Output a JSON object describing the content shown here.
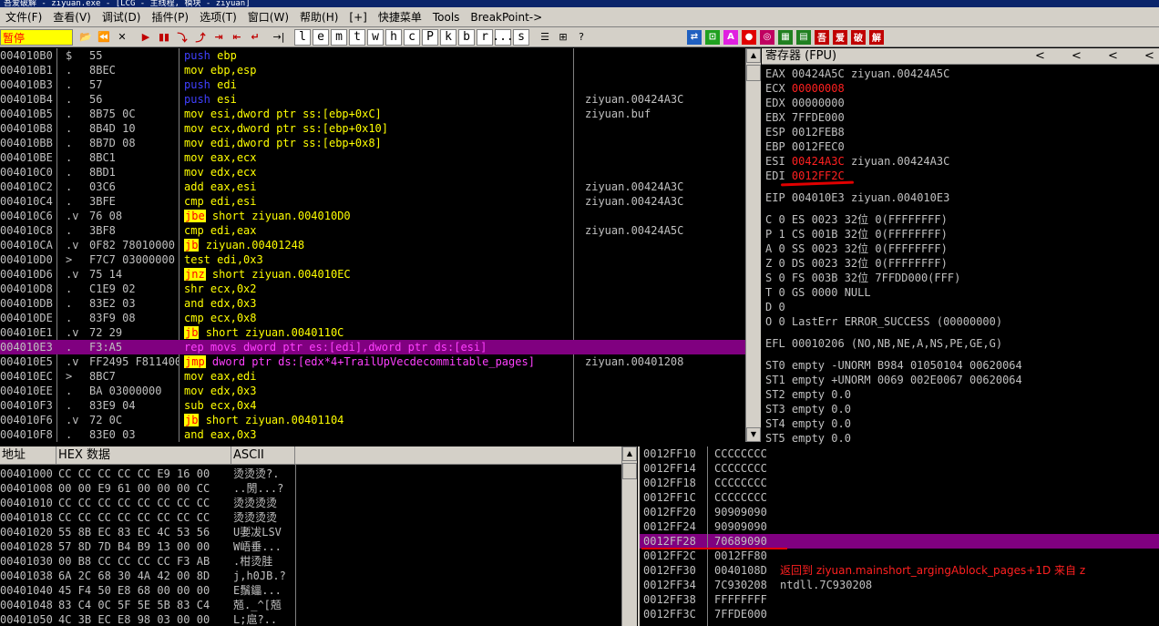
{
  "titlebar": {
    "text": "吾爱破解 - ziyuan.exe - [LCG - 主线程, 模块 - ziyuan]"
  },
  "menu": [
    "文件(F)",
    "查看(V)",
    "调试(D)",
    "插件(P)",
    "选项(T)",
    "窗口(W)",
    "帮助(H)",
    "[+]",
    "快捷菜单",
    "Tools",
    "BreakPoint->"
  ],
  "toolbar": {
    "status": "暂停",
    "buttons_left": [
      "📂",
      "⏪",
      "✕",
      "▶",
      "▮▮",
      "⤵",
      "⤴",
      "⇥",
      "⇤",
      "↵",
      "→|"
    ],
    "letters": [
      "l",
      "e",
      "m",
      "t",
      "w",
      "h",
      "c",
      "P",
      "k",
      "b",
      "r",
      "...",
      "s"
    ],
    "buttons_mid": [
      "☰",
      "⊞",
      "?"
    ],
    "buttons_right": [
      "⇄",
      "⊡",
      "A",
      "●",
      "◎",
      "▦",
      "▤",
      "吾",
      "爱",
      "破",
      "解"
    ]
  },
  "disasm": [
    {
      "addr": "004010B0",
      "mk": "$",
      "hex": "55",
      "op": "push",
      "args": "ebp",
      "opc": "blue",
      "cmt": ""
    },
    {
      "addr": "004010B1",
      "mk": ".",
      "hex": "8BEC",
      "op": "mov",
      "args": "ebp,esp",
      "opc": "yel",
      "cmt": ""
    },
    {
      "addr": "004010B3",
      "mk": ".",
      "hex": "57",
      "op": "push",
      "args": "edi",
      "opc": "blue",
      "cmt": ""
    },
    {
      "addr": "004010B4",
      "mk": ".",
      "hex": "56",
      "op": "push",
      "args": "esi",
      "opc": "blue",
      "cmt": "ziyuan.00424A3C"
    },
    {
      "addr": "004010B5",
      "mk": ".",
      "hex": "8B75 0C",
      "op": "mov",
      "args": "esi,dword ptr ss:[ebp+0xC]",
      "opc": "yel",
      "cmt": "ziyuan.buf"
    },
    {
      "addr": "004010B8",
      "mk": ".",
      "hex": "8B4D 10",
      "op": "mov",
      "args": "ecx,dword ptr ss:[ebp+0x10]",
      "opc": "yel",
      "cmt": ""
    },
    {
      "addr": "004010BB",
      "mk": ".",
      "hex": "8B7D 08",
      "op": "mov",
      "args": "edi,dword ptr ss:[ebp+0x8]",
      "opc": "yel",
      "cmt": ""
    },
    {
      "addr": "004010BE",
      "mk": ".",
      "hex": "8BC1",
      "op": "mov",
      "args": "eax,ecx",
      "opc": "yel",
      "cmt": ""
    },
    {
      "addr": "004010C0",
      "mk": ".",
      "hex": "8BD1",
      "op": "mov",
      "args": "edx,ecx",
      "opc": "yel",
      "cmt": ""
    },
    {
      "addr": "004010C2",
      "mk": ".",
      "hex": "03C6",
      "op": "add",
      "args": "eax,esi",
      "opc": "yel",
      "cmt": "ziyuan.00424A3C"
    },
    {
      "addr": "004010C4",
      "mk": ".",
      "hex": "3BFE",
      "op": "cmp",
      "args": "edi,esi",
      "opc": "yel",
      "cmt": "ziyuan.00424A3C"
    },
    {
      "addr": "004010C6",
      "mk": ".v",
      "hex": "76 08",
      "op": "jbe",
      "args": "short ziyuan.004010D0",
      "opc": "jcc",
      "cmt": ""
    },
    {
      "addr": "004010C8",
      "mk": ".",
      "hex": "3BF8",
      "op": "cmp",
      "args": "edi,eax",
      "opc": "yel",
      "cmt": "ziyuan.00424A5C"
    },
    {
      "addr": "004010CA",
      "mk": ".v",
      "hex": "0F82 78010000",
      "op": "jb",
      "args": "ziyuan.00401248",
      "opc": "jcc",
      "cmt": ""
    },
    {
      "addr": "004010D0",
      "mk": ">",
      "hex": "F7C7 03000000",
      "op": "test",
      "args": "edi,0x3",
      "opc": "yel",
      "cmt": ""
    },
    {
      "addr": "004010D6",
      "mk": ".v",
      "hex": "75 14",
      "op": "jnz",
      "args": "short ziyuan.004010EC",
      "opc": "jcc",
      "cmt": ""
    },
    {
      "addr": "004010D8",
      "mk": ".",
      "hex": "C1E9 02",
      "op": "shr",
      "args": "ecx,0x2",
      "opc": "yel",
      "cmt": ""
    },
    {
      "addr": "004010DB",
      "mk": ".",
      "hex": "83E2 03",
      "op": "and",
      "args": "edx,0x3",
      "opc": "yel",
      "cmt": ""
    },
    {
      "addr": "004010DE",
      "mk": ".",
      "hex": "83F9 08",
      "op": "cmp",
      "args": "ecx,0x8",
      "opc": "yel",
      "cmt": ""
    },
    {
      "addr": "004010E1",
      "mk": ".v",
      "hex": "72 29",
      "op": "jb",
      "args": "short ziyuan.0040110C",
      "opc": "jcc",
      "cmt": ""
    },
    {
      "addr": "004010E3",
      "mk": ".",
      "hex": "F3:A5",
      "op": "rep movs",
      "args": "dword ptr es:[edi],dword ptr ds:[esi]",
      "opc": "mag",
      "cmt": "",
      "selected": true
    },
    {
      "addr": "004010E5",
      "mk": ".v",
      "hex": "FF2495 F8114000",
      "op": "jmp",
      "args": "dword ptr ds:[edx*4+TrailUpVecdecommitable_pages]",
      "opc": "jmp",
      "cmt": "ziyuan.00401208"
    },
    {
      "addr": "004010EC",
      "mk": ">",
      "hex": "8BC7",
      "op": "mov",
      "args": "eax,edi",
      "opc": "yel",
      "cmt": ""
    },
    {
      "addr": "004010EE",
      "mk": ".",
      "hex": "BA 03000000",
      "op": "mov",
      "args": "edx,0x3",
      "opc": "yel",
      "cmt": ""
    },
    {
      "addr": "004010F3",
      "mk": ".",
      "hex": "83E9 04",
      "op": "sub",
      "args": "ecx,0x4",
      "opc": "yel",
      "cmt": ""
    },
    {
      "addr": "004010F6",
      "mk": ".v",
      "hex": "72 0C",
      "op": "jb",
      "args": "short ziyuan.00401104",
      "opc": "jcc",
      "cmt": ""
    },
    {
      "addr": "004010F8",
      "mk": ".",
      "hex": "83E0 03",
      "op": "and",
      "args": "eax,0x3",
      "opc": "yel",
      "cmt": ""
    }
  ],
  "registers": {
    "header": "寄存器 (FPU)",
    "arrows": [
      "<",
      "<",
      "<",
      "<"
    ],
    "lines": [
      {
        "name": "EAX",
        "val": "00424A5C",
        "cmt": "ziyuan.00424A5C",
        "changed": false
      },
      {
        "name": "ECX",
        "val": "00000008",
        "cmt": "",
        "changed": true
      },
      {
        "name": "EDX",
        "val": "00000000",
        "cmt": "",
        "changed": false
      },
      {
        "name": "EBX",
        "val": "7FFDE000",
        "cmt": "",
        "changed": false
      },
      {
        "name": "ESP",
        "val": "0012FEB8",
        "cmt": "",
        "changed": false
      },
      {
        "name": "EBP",
        "val": "0012FEC0",
        "cmt": "",
        "changed": false
      },
      {
        "name": "ESI",
        "val": "00424A3C",
        "cmt": "ziyuan.00424A3C",
        "changed": true
      },
      {
        "name": "EDI",
        "val": "0012FF2C",
        "cmt": "",
        "changed": true
      }
    ],
    "eip": {
      "name": "EIP",
      "val": "004010E3",
      "cmt": "ziyuan.004010E3"
    },
    "flags": [
      "C 0  ES 0023 32位 0(FFFFFFFF)",
      "P 1  CS 001B 32位 0(FFFFFFFF)",
      "A 0  SS 0023 32位 0(FFFFFFFF)",
      "Z 0  DS 0023 32位 0(FFFFFFFF)",
      "S 0  FS 003B 32位 7FFDD000(FFF)",
      "T 0  GS 0000 NULL",
      "D 0",
      "O 0  LastErr ERROR_SUCCESS (00000000)"
    ],
    "efl": "EFL 00010206 (NO,NB,NE,A,NS,PE,GE,G)",
    "fpu": [
      "ST0 empty -UNORM B984 01050104 00620064",
      "ST1 empty +UNORM 0069 002E0067 00620064",
      "ST2 empty 0.0",
      "ST3 empty 0.0",
      "ST4 empty 0.0",
      "ST5 empty 0.0"
    ]
  },
  "dump": {
    "headers": [
      "地址",
      "HEX 数据",
      "ASCII"
    ],
    "rows": [
      {
        "addr": "00401000",
        "hex": "CC CC CC CC CC E9 16 00",
        "ascii": "烫烫烫?."
      },
      {
        "addr": "00401008",
        "hex": "00 00 E9 61 00 00 00 CC",
        "ascii": "..閍...?"
      },
      {
        "addr": "00401010",
        "hex": "CC CC CC CC CC CC CC CC",
        "ascii": "烫烫烫烫"
      },
      {
        "addr": "00401018",
        "hex": "CC CC CC CC CC CC CC CC",
        "ascii": "烫烫烫烫"
      },
      {
        "addr": "00401020",
        "hex": "55 8B EC 83 EC 4C 53 56",
        "ascii": "U嬱冹LSV"
      },
      {
        "addr": "00401028",
        "hex": "57 8D 7D B4 B9 13 00 00",
        "ascii": "W峿垂..."
      },
      {
        "addr": "00401030",
        "hex": "00 B8 CC CC CC CC F3 AB",
        "ascii": ".柑烫胿"
      },
      {
        "addr": "00401038",
        "hex": "6A 2C 68 30 4A 42 00 8D",
        "ascii": "j,h0JB.?"
      },
      {
        "addr": "00401040",
        "hex": "45 F4 50 E8 68 00 00 00",
        "ascii": "E鬚鑘..."
      },
      {
        "addr": "00401048",
        "hex": "83 C4 0C 5F 5E 5B 83 C4",
        "ascii": "兡._^[兡"
      },
      {
        "addr": "00401050",
        "hex": "4C 3B EC E8 98 03 00 00",
        "ascii": "L;扈?.."
      }
    ]
  },
  "stack": [
    {
      "addr": "0012FF10",
      "val": "CCCCCCCC",
      "cmt": "",
      "selected": false
    },
    {
      "addr": "0012FF14",
      "val": "CCCCCCCC",
      "cmt": "",
      "selected": false
    },
    {
      "addr": "0012FF18",
      "val": "CCCCCCCC",
      "cmt": "",
      "selected": false
    },
    {
      "addr": "0012FF1C",
      "val": "CCCCCCCC",
      "cmt": "",
      "selected": false
    },
    {
      "addr": "0012FF20",
      "val": "90909090",
      "cmt": "",
      "selected": false
    },
    {
      "addr": "0012FF24",
      "val": "90909090",
      "cmt": "",
      "selected": false
    },
    {
      "addr": "0012FF28",
      "val": "70689090",
      "cmt": "",
      "selected": true
    },
    {
      "addr": "0012FF2C",
      "val": "0012FF80",
      "cmt": "",
      "selected": false
    },
    {
      "addr": "0012FF30",
      "val": "0040108D",
      "cmt": "返回到 ziyuan.mainshort_argingAblock_pages+1D 来自 z",
      "selected": false,
      "red": true
    },
    {
      "addr": "0012FF34",
      "val": "7C930208",
      "cmt": "ntdll.7C930208",
      "selected": false
    },
    {
      "addr": "0012FF38",
      "val": "FFFFFFFF",
      "cmt": "",
      "selected": false
    },
    {
      "addr": "0012FF3C",
      "val": "7FFDE000",
      "cmt": "",
      "selected": false
    }
  ]
}
